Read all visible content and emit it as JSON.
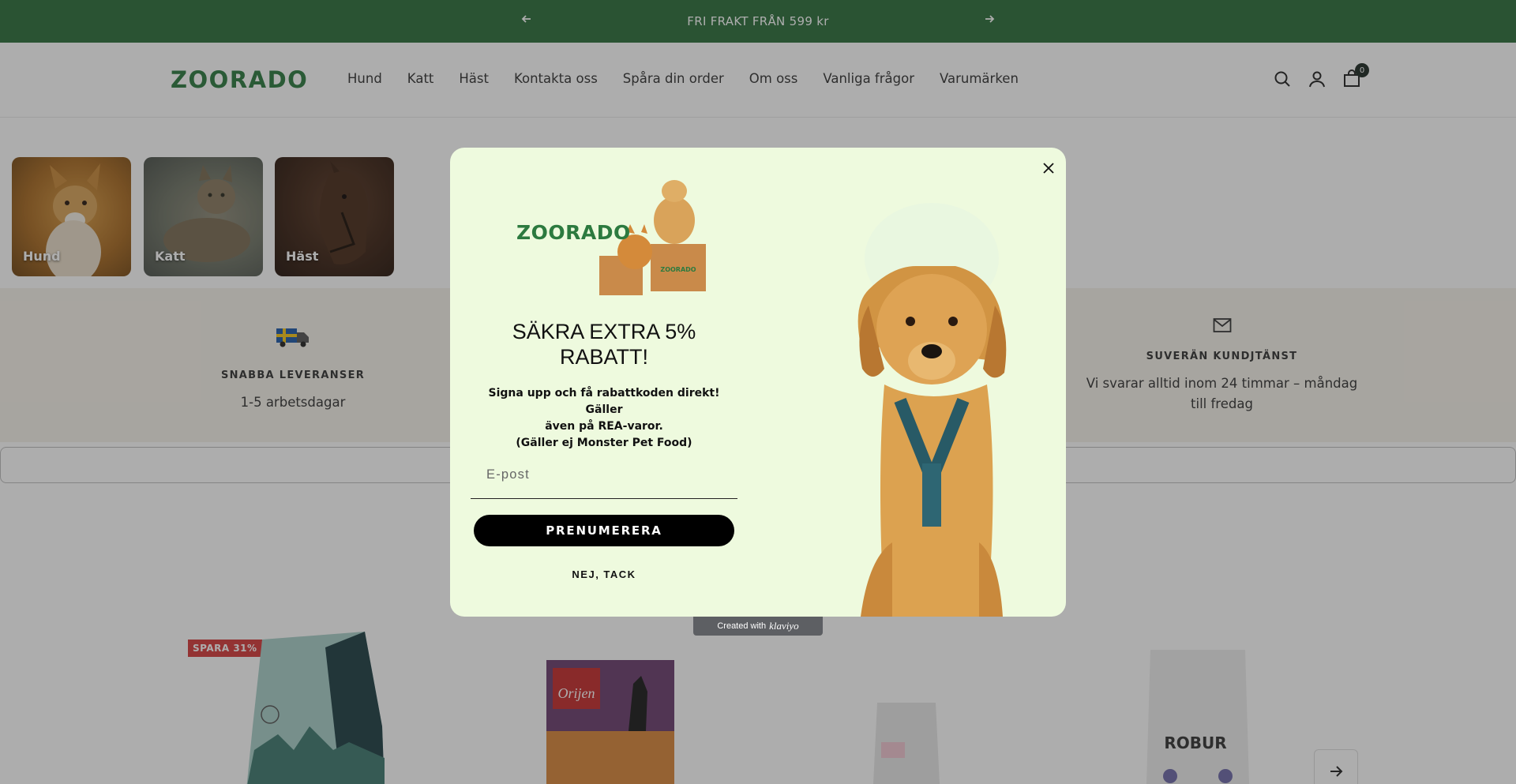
{
  "announcement": {
    "text": "FRI FRAKT FRÅN 599 kr",
    "prev_icon": "arrow-left-icon",
    "next_icon": "arrow-right-icon"
  },
  "header": {
    "logo": "ZOORADO",
    "nav": [
      "Hund",
      "Katt",
      "Häst",
      "Kontakta oss",
      "Spåra din order",
      "Om oss",
      "Vanliga frågor",
      "Varumärken"
    ],
    "cart_count": "0",
    "icons": [
      "search-icon",
      "account-icon",
      "cart-icon"
    ]
  },
  "categories": [
    {
      "label": "Hund"
    },
    {
      "label": "Katt"
    },
    {
      "label": "Häst"
    }
  ],
  "usps": [
    {
      "title": "SNABBA LEVERANSER",
      "desc": "1-5 arbetsdagar",
      "icon": "truck-icon"
    },
    {
      "title": "SUVERÄN KUNDJTÄNST",
      "desc_line1": "Vi svarar alltid inom 24 timmar – måndag",
      "desc_line2": "till fredag",
      "icon": "mail-icon"
    }
  ],
  "products": {
    "badge": "SPARA 31%",
    "brands": [
      "Orijen",
      "ROBUR"
    ]
  },
  "popup": {
    "logo": "ZOORADO",
    "box_text": "ZOORADO",
    "headline_line1": "SÄKRA EXTRA 5%",
    "headline_line2": "RABATT!",
    "sub_line1": "Signa upp och få rabattkoden direkt! Gäller",
    "sub_line2": "även på REA-varor.",
    "sub_line3": "(Gäller ej Monster Pet Food)",
    "email_placeholder": "E-post",
    "subscribe_label": "PRENUMERERA",
    "decline_label": "NEJ, TACK",
    "close_icon": "close-icon"
  },
  "klaviyo": {
    "prefix": "Created with",
    "brand": "klaviyo"
  },
  "colors": {
    "brand_green": "#2c7a3f",
    "announce_bg": "#2c6e3b",
    "popup_bg": "#eefade",
    "sale_red": "#d63b3b"
  }
}
